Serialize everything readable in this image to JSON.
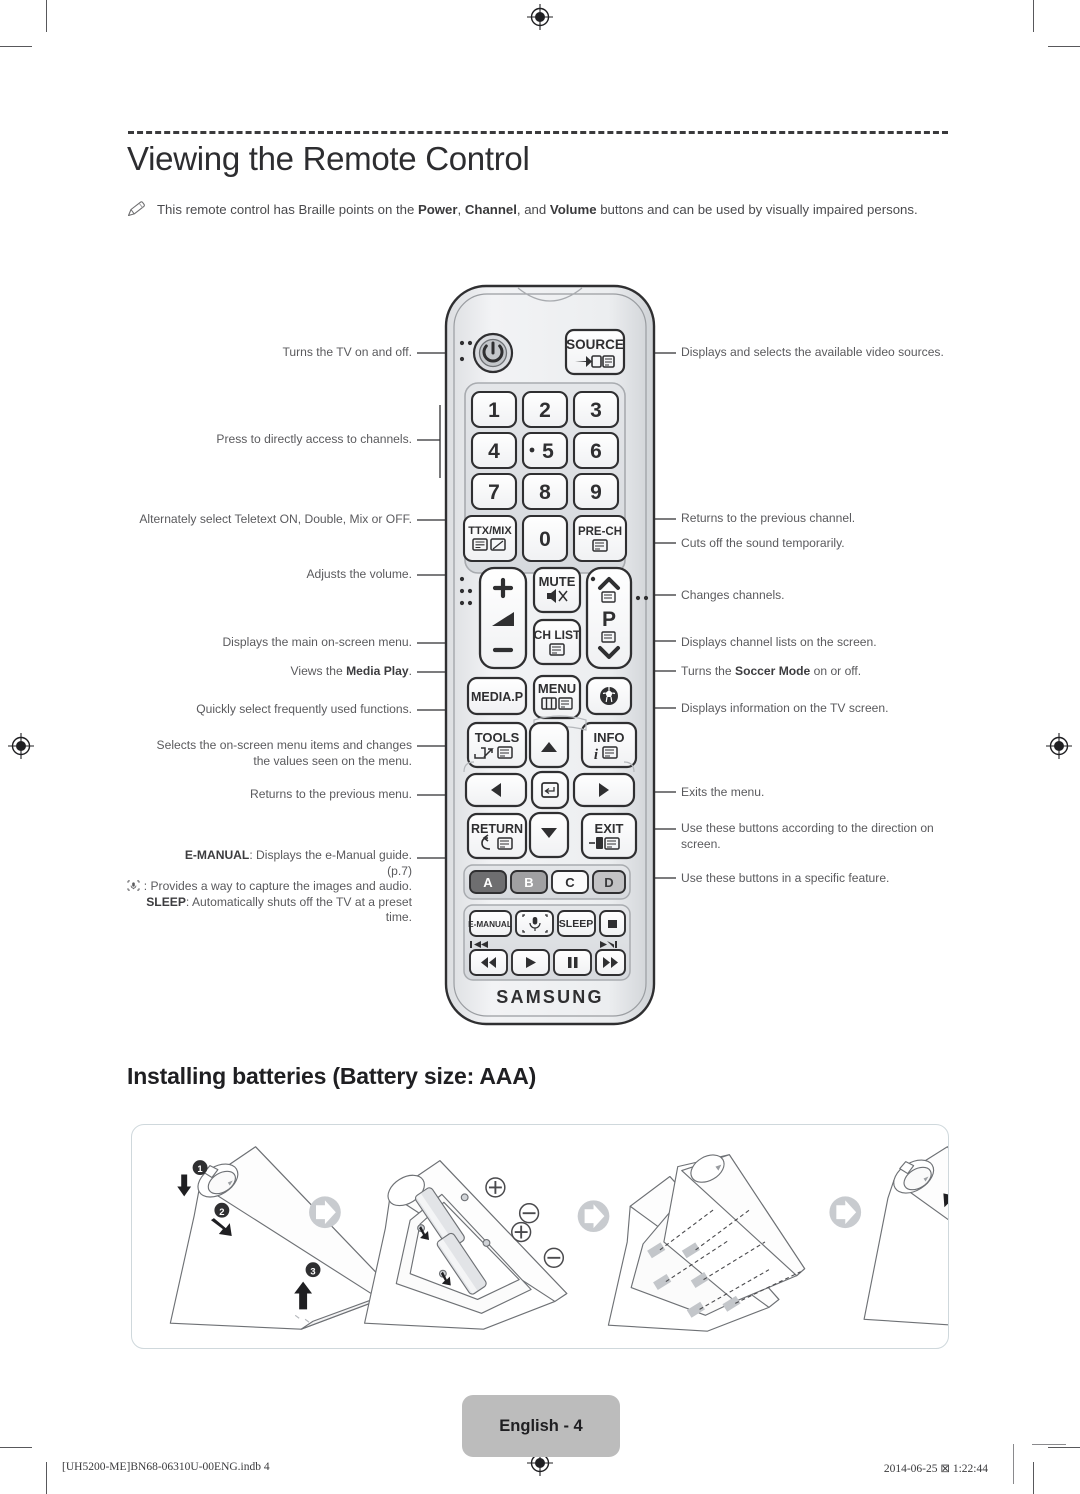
{
  "page": {
    "heading": "Viewing the Remote Control",
    "note_icon": "pencil-note-icon",
    "note_prefix": "This remote control has Braille points on the ",
    "note_bold_1": "Power",
    "note_mid_1": ", ",
    "note_bold_2": "Channel",
    "note_mid_2": ", and ",
    "note_bold_3": "Volume",
    "note_suffix": " buttons and can be used by visually impaired persons.",
    "subheading": "Installing batteries (Battery size: AAA)",
    "page_badge": "English - 4",
    "footer_left": "[UH5200-ME]BN68-06310U-00ENG.indb   4",
    "footer_right": "2014-06-25   ⊠ 1:22:44"
  },
  "callouts_left": [
    {
      "id": "power",
      "text": "Turns the TV on and off."
    },
    {
      "id": "numbers",
      "text": "Press to directly access to channels."
    },
    {
      "id": "ttxmix",
      "text": "Alternately select Teletext ON, Double, Mix or OFF."
    },
    {
      "id": "volume",
      "text": "Adjusts the volume."
    },
    {
      "id": "menu",
      "text": "Displays the main on-screen menu."
    },
    {
      "id": "mediap",
      "text_pre": "Views the ",
      "text_bold": "Media Play",
      "text_post": "."
    },
    {
      "id": "tools",
      "text": "Quickly select frequently used functions."
    },
    {
      "id": "arrows",
      "text": "Selects the on-screen menu items and changes the values seen on the menu."
    },
    {
      "id": "return",
      "text": "Returns to the previous menu."
    }
  ],
  "callouts_left_block": {
    "emanual_bold": "E-MANUAL",
    "emanual_text": ": Displays the e-Manual guide.",
    "emanual_page": "(p.7)",
    "mic_icon": "voice-capture-icon",
    "mic_text": " : Provides a way to capture the images and audio.",
    "sleep_bold": "SLEEP",
    "sleep_text": ": Automatically shuts off the TV at a preset time."
  },
  "callouts_right": [
    {
      "id": "source",
      "text": "Displays and selects the available video sources."
    },
    {
      "id": "prech",
      "text": "Returns to the previous channel."
    },
    {
      "id": "mute",
      "text": "Cuts off the sound temporarily."
    },
    {
      "id": "channel",
      "text": "Changes channels."
    },
    {
      "id": "chlist",
      "text": "Displays channel lists on the screen."
    },
    {
      "id": "soccer",
      "text_pre": "Turns the ",
      "text_bold": "Soccer Mode",
      "text_post": " on or off."
    },
    {
      "id": "info",
      "text": "Displays information on the TV screen."
    },
    {
      "id": "exit",
      "text": "Exits the menu."
    },
    {
      "id": "abcd",
      "text": "Use these buttons according to the direction on screen."
    },
    {
      "id": "media",
      "text": "Use these buttons in a specific feature."
    }
  ],
  "remote": {
    "brand": "SAMSUNG",
    "buttons": {
      "power": "power-icon",
      "source": "SOURCE",
      "numbers": [
        "1",
        "2",
        "3",
        "4",
        "5",
        "6",
        "7",
        "8",
        "9",
        "0"
      ],
      "ttxmix": "TTX/MIX",
      "prech": "PRE-CH",
      "volume_up": "+",
      "volume_down": "−",
      "volume_icon": "volume-icon",
      "mute": "MUTE",
      "chlist": "CH LIST",
      "channel_label": "P",
      "channel_up": "chevron-up-icon",
      "channel_down": "chevron-down-icon",
      "mediap": "MEDIA.P",
      "menu": "MENU",
      "soccer": "soccer-ball-icon",
      "tools": "TOOLS",
      "info": "INFO",
      "enter": "enter-icon",
      "return": "RETURN",
      "exit": "EXIT",
      "color_a": "A",
      "color_b": "B",
      "color_c": "C",
      "color_d": "D",
      "emanual": "E-MANUAL",
      "voice": "voice-capture-icon",
      "sleep": "SLEEP",
      "stop": "stop-icon",
      "rewind": "rewind-icon",
      "play": "play-icon",
      "pause": "pause-icon",
      "forward": "fast-forward-icon",
      "skip_prev": "skip-previous-icon",
      "skip_next": "skip-next-icon"
    }
  },
  "battery_steps": {
    "step_1": "1",
    "step_2": "2",
    "step_3": "3",
    "polarity_plus": "+",
    "polarity_minus": "−"
  },
  "colors": {
    "body_text": "#5a5a5d",
    "heading": "#2d2d30",
    "remote_body": "#e9eaec",
    "remote_outline": "#3a3a3c",
    "button_fill": "#ffffff",
    "color_a": "#6e6e70",
    "color_b": "#a0a0a2",
    "color_c": "#fbfbfb",
    "color_d": "#c2c2c4",
    "badge_gray": "#bcbcbc",
    "box_border": "#cfd8dc"
  }
}
